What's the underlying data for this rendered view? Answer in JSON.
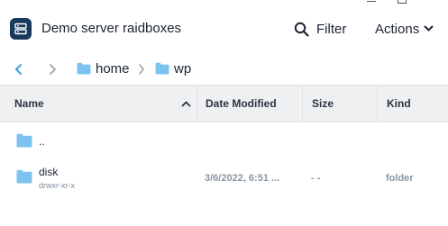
{
  "window": {
    "title": "Demo server raidboxes"
  },
  "toolbar": {
    "filter_label": "Filter",
    "actions_label": "Actions"
  },
  "breadcrumb": {
    "items": [
      "home",
      "wp"
    ]
  },
  "table": {
    "columns": [
      "Name",
      "Date Modified",
      "Size",
      "Kind"
    ],
    "rows": [
      {
        "name": "..",
        "permissions": "",
        "date": "",
        "size": "",
        "kind": ""
      },
      {
        "name": "disk",
        "permissions": "drwxr-xr-x",
        "date": "3/6/2022, 6:51 ...",
        "size": "- -",
        "kind": "folder"
      }
    ]
  },
  "colors": {
    "accent": "#3b9de0",
    "folder": "#7cc3ef",
    "header_bg": "#eef0f2",
    "app_icon_bg": "#183a5c"
  }
}
